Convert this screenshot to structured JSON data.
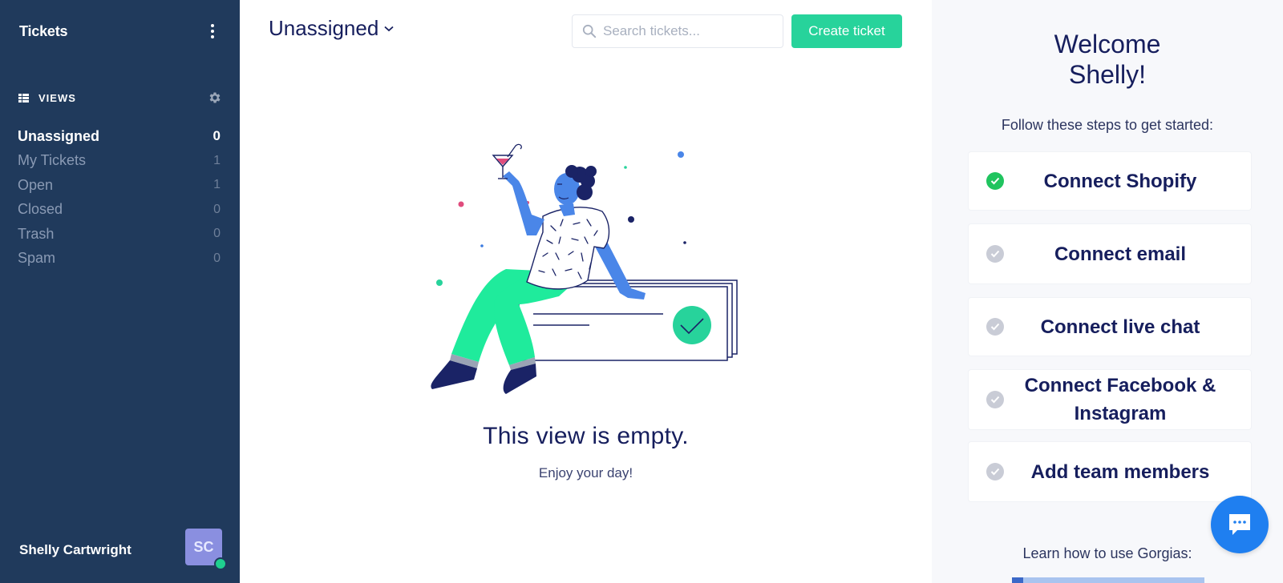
{
  "sidebar": {
    "title": "Tickets",
    "views_label": "VIEWS",
    "views": [
      {
        "label": "Unassigned",
        "count": "0",
        "active": true
      },
      {
        "label": "My Tickets",
        "count": "1",
        "active": false
      },
      {
        "label": "Open",
        "count": "1",
        "active": false
      },
      {
        "label": "Closed",
        "count": "0",
        "active": false
      },
      {
        "label": "Trash",
        "count": "0",
        "active": false
      },
      {
        "label": "Spam",
        "count": "0",
        "active": false
      }
    ],
    "user": {
      "name": "Shelly Cartwright",
      "initials": "SC"
    }
  },
  "main": {
    "view_title": "Unassigned",
    "search_placeholder": "Search tickets...",
    "create_button": "Create ticket",
    "empty_title": "This view is empty.",
    "empty_subtitle": "Enjoy your day!"
  },
  "onboarding": {
    "welcome_line1": "Welcome",
    "welcome_line2": "Shelly!",
    "intro": "Follow these steps to get started:",
    "steps": [
      {
        "label": "Connect Shopify",
        "done": true
      },
      {
        "label": "Connect email",
        "done": false
      },
      {
        "label": "Connect live chat",
        "done": false
      },
      {
        "label": "Connect Facebook & Instagram",
        "done": false
      },
      {
        "label": "Add team members",
        "done": false
      }
    ],
    "learn_text": "Learn how to use Gorgias:"
  },
  "colors": {
    "sidebar_bg": "#203a5c",
    "accent_green": "#27d39b",
    "navy_text": "#161e5d",
    "done_check": "#20c45f",
    "pending_check": "#c9ccd6",
    "chat_blue": "#1f7ff0"
  },
  "icons": {
    "menu": "kebab-menu-icon",
    "views": "list-icon",
    "settings": "gear-icon",
    "search": "search-icon",
    "chevron": "chevron-down-icon",
    "check": "check-circle-icon",
    "chat": "chat-bubble-icon"
  }
}
